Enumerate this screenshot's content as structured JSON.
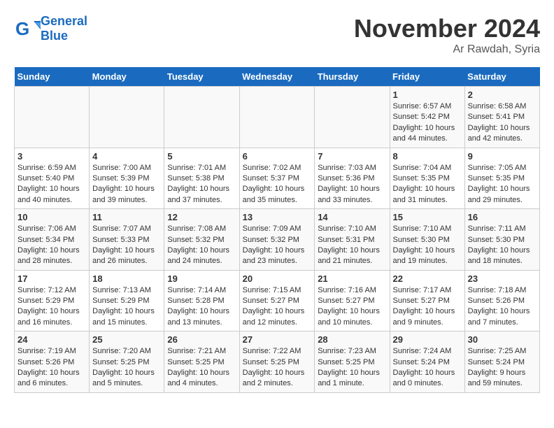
{
  "header": {
    "logo_line1": "General",
    "logo_line2": "Blue",
    "month_year": "November 2024",
    "location": "Ar Rawdah, Syria"
  },
  "days_of_week": [
    "Sunday",
    "Monday",
    "Tuesday",
    "Wednesday",
    "Thursday",
    "Friday",
    "Saturday"
  ],
  "weeks": [
    [
      {
        "day": "",
        "info": ""
      },
      {
        "day": "",
        "info": ""
      },
      {
        "day": "",
        "info": ""
      },
      {
        "day": "",
        "info": ""
      },
      {
        "day": "",
        "info": ""
      },
      {
        "day": "1",
        "info": "Sunrise: 6:57 AM\nSunset: 5:42 PM\nDaylight: 10 hours and 44 minutes."
      },
      {
        "day": "2",
        "info": "Sunrise: 6:58 AM\nSunset: 5:41 PM\nDaylight: 10 hours and 42 minutes."
      }
    ],
    [
      {
        "day": "3",
        "info": "Sunrise: 6:59 AM\nSunset: 5:40 PM\nDaylight: 10 hours and 40 minutes."
      },
      {
        "day": "4",
        "info": "Sunrise: 7:00 AM\nSunset: 5:39 PM\nDaylight: 10 hours and 39 minutes."
      },
      {
        "day": "5",
        "info": "Sunrise: 7:01 AM\nSunset: 5:38 PM\nDaylight: 10 hours and 37 minutes."
      },
      {
        "day": "6",
        "info": "Sunrise: 7:02 AM\nSunset: 5:37 PM\nDaylight: 10 hours and 35 minutes."
      },
      {
        "day": "7",
        "info": "Sunrise: 7:03 AM\nSunset: 5:36 PM\nDaylight: 10 hours and 33 minutes."
      },
      {
        "day": "8",
        "info": "Sunrise: 7:04 AM\nSunset: 5:35 PM\nDaylight: 10 hours and 31 minutes."
      },
      {
        "day": "9",
        "info": "Sunrise: 7:05 AM\nSunset: 5:35 PM\nDaylight: 10 hours and 29 minutes."
      }
    ],
    [
      {
        "day": "10",
        "info": "Sunrise: 7:06 AM\nSunset: 5:34 PM\nDaylight: 10 hours and 28 minutes."
      },
      {
        "day": "11",
        "info": "Sunrise: 7:07 AM\nSunset: 5:33 PM\nDaylight: 10 hours and 26 minutes."
      },
      {
        "day": "12",
        "info": "Sunrise: 7:08 AM\nSunset: 5:32 PM\nDaylight: 10 hours and 24 minutes."
      },
      {
        "day": "13",
        "info": "Sunrise: 7:09 AM\nSunset: 5:32 PM\nDaylight: 10 hours and 23 minutes."
      },
      {
        "day": "14",
        "info": "Sunrise: 7:10 AM\nSunset: 5:31 PM\nDaylight: 10 hours and 21 minutes."
      },
      {
        "day": "15",
        "info": "Sunrise: 7:10 AM\nSunset: 5:30 PM\nDaylight: 10 hours and 19 minutes."
      },
      {
        "day": "16",
        "info": "Sunrise: 7:11 AM\nSunset: 5:30 PM\nDaylight: 10 hours and 18 minutes."
      }
    ],
    [
      {
        "day": "17",
        "info": "Sunrise: 7:12 AM\nSunset: 5:29 PM\nDaylight: 10 hours and 16 minutes."
      },
      {
        "day": "18",
        "info": "Sunrise: 7:13 AM\nSunset: 5:29 PM\nDaylight: 10 hours and 15 minutes."
      },
      {
        "day": "19",
        "info": "Sunrise: 7:14 AM\nSunset: 5:28 PM\nDaylight: 10 hours and 13 minutes."
      },
      {
        "day": "20",
        "info": "Sunrise: 7:15 AM\nSunset: 5:27 PM\nDaylight: 10 hours and 12 minutes."
      },
      {
        "day": "21",
        "info": "Sunrise: 7:16 AM\nSunset: 5:27 PM\nDaylight: 10 hours and 10 minutes."
      },
      {
        "day": "22",
        "info": "Sunrise: 7:17 AM\nSunset: 5:27 PM\nDaylight: 10 hours and 9 minutes."
      },
      {
        "day": "23",
        "info": "Sunrise: 7:18 AM\nSunset: 5:26 PM\nDaylight: 10 hours and 7 minutes."
      }
    ],
    [
      {
        "day": "24",
        "info": "Sunrise: 7:19 AM\nSunset: 5:26 PM\nDaylight: 10 hours and 6 minutes."
      },
      {
        "day": "25",
        "info": "Sunrise: 7:20 AM\nSunset: 5:25 PM\nDaylight: 10 hours and 5 minutes."
      },
      {
        "day": "26",
        "info": "Sunrise: 7:21 AM\nSunset: 5:25 PM\nDaylight: 10 hours and 4 minutes."
      },
      {
        "day": "27",
        "info": "Sunrise: 7:22 AM\nSunset: 5:25 PM\nDaylight: 10 hours and 2 minutes."
      },
      {
        "day": "28",
        "info": "Sunrise: 7:23 AM\nSunset: 5:25 PM\nDaylight: 10 hours and 1 minute."
      },
      {
        "day": "29",
        "info": "Sunrise: 7:24 AM\nSunset: 5:24 PM\nDaylight: 10 hours and 0 minutes."
      },
      {
        "day": "30",
        "info": "Sunrise: 7:25 AM\nSunset: 5:24 PM\nDaylight: 9 hours and 59 minutes."
      }
    ]
  ]
}
